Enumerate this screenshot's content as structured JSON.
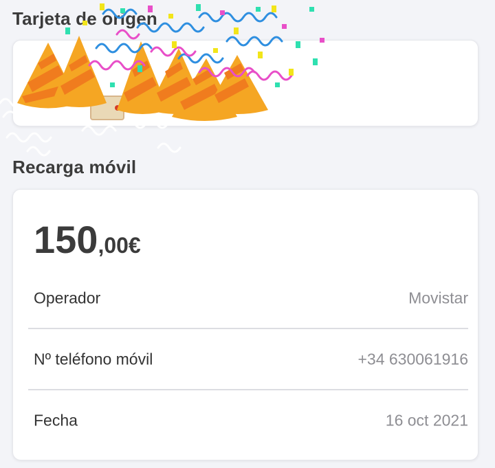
{
  "sections": {
    "origin": {
      "title": "Tarjeta de origen"
    },
    "recharge": {
      "title": "Recarga móvil",
      "amount": {
        "integer": "150",
        "decimal": ",00€"
      },
      "rows": [
        {
          "label": "Operador",
          "value": "Movistar"
        },
        {
          "label": "Nº teléfono móvil",
          "value": "+34 630061916"
        },
        {
          "label": "Fecha",
          "value": "16 oct 2021"
        }
      ]
    }
  },
  "overlay": {
    "icon": "party-confetti-icon",
    "colors": {
      "hat_orange": "#f5a623",
      "hat_stripe": "#f07c1e",
      "streamer_blue": "#2f8fe0",
      "streamer_pink": "#e84fc8",
      "confetti_yellow": "#f2e51a",
      "confetti_teal": "#2fe0b0"
    }
  }
}
